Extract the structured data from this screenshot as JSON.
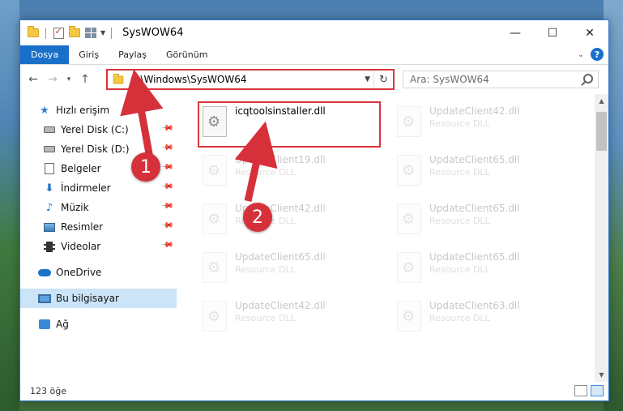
{
  "window": {
    "title": "SysWOW64",
    "controls": {
      "minimize": "—",
      "maximize": "☐",
      "close": "✕"
    }
  },
  "ribbon": {
    "tabs": [
      {
        "label": "Dosya",
        "active": true
      },
      {
        "label": "Giriş",
        "active": false
      },
      {
        "label": "Paylaş",
        "active": false
      },
      {
        "label": "Görünüm",
        "active": false
      }
    ],
    "help": "?"
  },
  "address": {
    "path": "C:\\Windows\\SysWOW64",
    "search_placeholder": "Ara: SysWOW64"
  },
  "nav": {
    "quick_access": "Hızlı erişim",
    "items": [
      {
        "label": "Yerel Disk (C:)",
        "icon": "drive-icon",
        "pinned": true
      },
      {
        "label": "Yerel Disk (D:)",
        "icon": "drive-icon",
        "pinned": true
      },
      {
        "label": "Belgeler",
        "icon": "documents-icon",
        "pinned": true
      },
      {
        "label": "İndirmeler",
        "icon": "downloads-icon",
        "pinned": true
      },
      {
        "label": "Müzik",
        "icon": "music-icon",
        "pinned": true
      },
      {
        "label": "Resimler",
        "icon": "pictures-icon",
        "pinned": true
      },
      {
        "label": "Videolar",
        "icon": "videos-icon",
        "pinned": true
      }
    ],
    "onedrive": "OneDrive",
    "this_pc": "Bu bilgisayar",
    "network": "Ağ"
  },
  "files": {
    "highlighted": {
      "name": "icqtoolsinstaller.dll",
      "type": ""
    },
    "faded": [
      {
        "name": "UpdateClient42.dll",
        "type": "Resource DLL"
      },
      {
        "name": "UpdateClient19.dll",
        "type": "Resource DLL"
      },
      {
        "name": "UpdateClient65.dll",
        "type": "Resource DLL"
      },
      {
        "name": "UpdateClient42.dll",
        "type": "Resource DLL"
      },
      {
        "name": "UpdateClient65.dll",
        "type": "Resource DLL"
      },
      {
        "name": "UpdateClient65.dll",
        "type": "Resource DLL"
      },
      {
        "name": "UpdateClient65.dll",
        "type": "Resource DLL"
      },
      {
        "name": "UpdateClient42.dll",
        "type": "Resource DLL"
      },
      {
        "name": "UpdateClient63.dll",
        "type": "Resource DLL"
      }
    ]
  },
  "status": {
    "count": "123 öğe"
  },
  "annotations": {
    "marker1": "1",
    "marker2": "2",
    "color": "#d6313a"
  }
}
